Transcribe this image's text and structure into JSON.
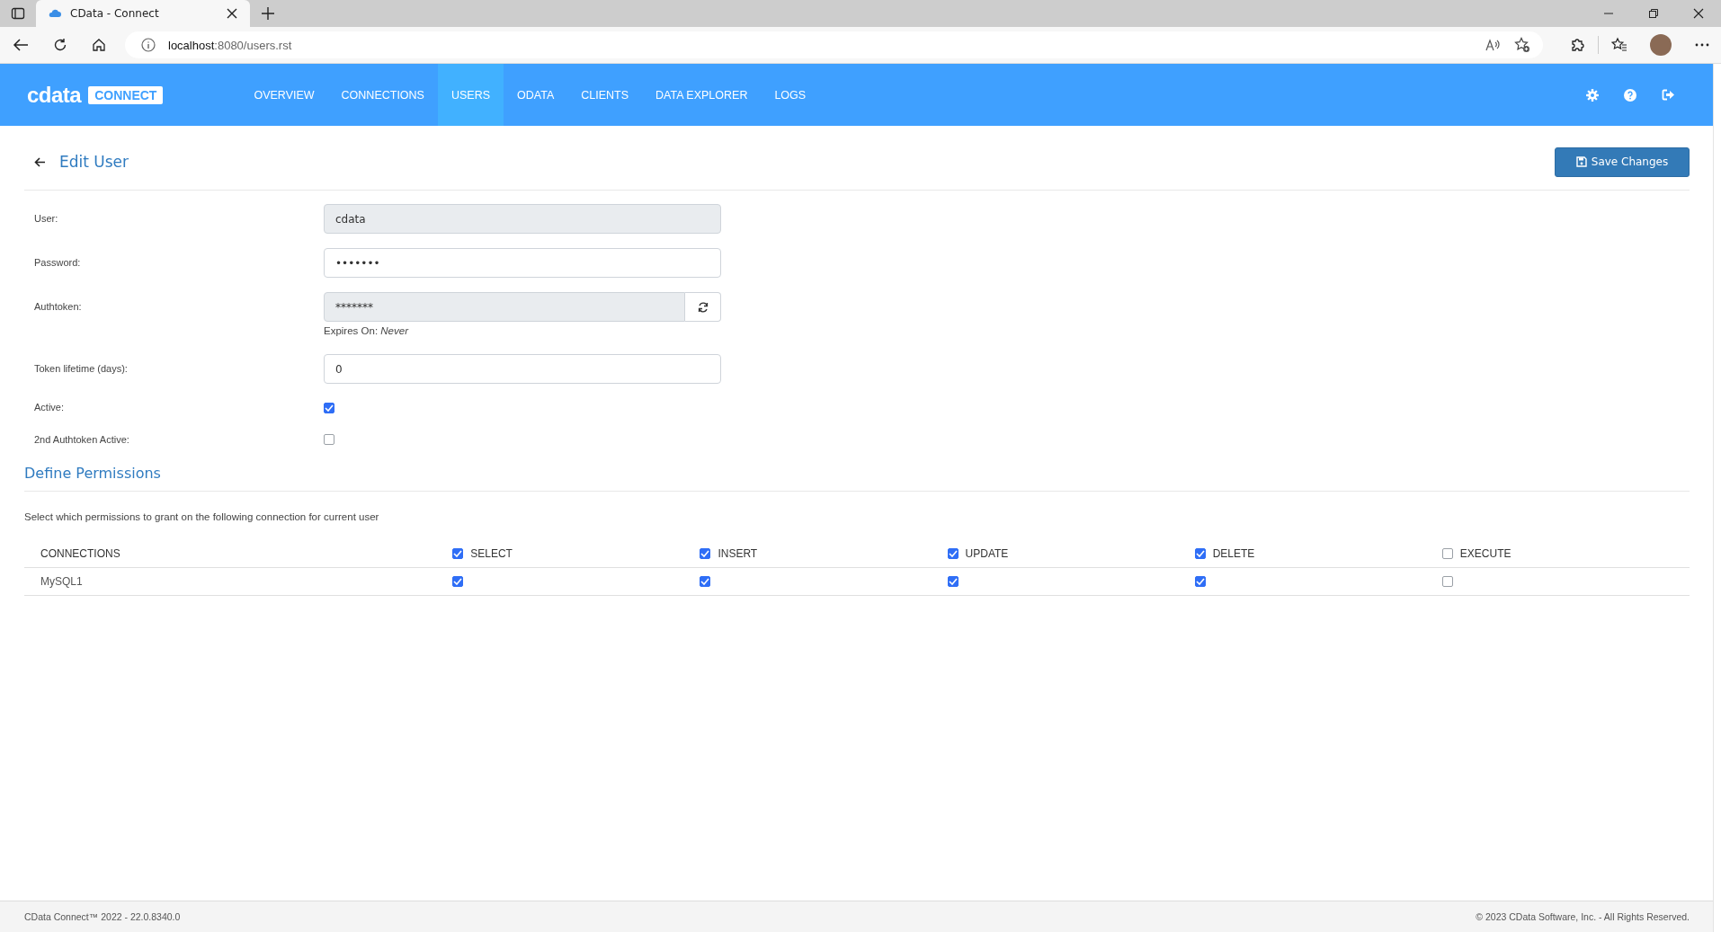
{
  "browser": {
    "tab_title": "CData - Connect",
    "url_host": "localhost",
    "url_path": ":8080/users.rst"
  },
  "header": {
    "logo_text": "cdata",
    "logo_badge": "CONNECT",
    "nav": [
      {
        "label": "OVERVIEW",
        "selected": false
      },
      {
        "label": "CONNECTIONS",
        "selected": false
      },
      {
        "label": "USERS",
        "selected": true
      },
      {
        "label": "ODATA",
        "selected": false
      },
      {
        "label": "CLIENTS",
        "selected": false
      },
      {
        "label": "DATA EXPLORER",
        "selected": false
      },
      {
        "label": "LOGS",
        "selected": false
      }
    ]
  },
  "page": {
    "title": "Edit User",
    "save_button": "Save Changes"
  },
  "form": [
    {
      "kind": "text",
      "label": "User:",
      "value": "cdata",
      "disabled": true
    },
    {
      "kind": "text",
      "label": "Password:",
      "value": "•••••••",
      "disabled": false
    },
    {
      "kind": "token",
      "label": "Authtoken:",
      "value": "*******",
      "disabled": true,
      "expires_label": "Expires On:",
      "expires_value": "Never"
    },
    {
      "kind": "text",
      "label": "Token lifetime (days):",
      "value": "0",
      "disabled": false
    },
    {
      "kind": "checkbox",
      "label": "Active:",
      "checked": true
    },
    {
      "kind": "checkbox",
      "label": "2nd Authtoken Active:",
      "checked": false
    }
  ],
  "permissions": {
    "title": "Define Permissions",
    "description": "Select which permissions to grant on the following connection for current user",
    "first_column": "CONNECTIONS",
    "columns": [
      {
        "label": "SELECT",
        "checked": true
      },
      {
        "label": "INSERT",
        "checked": true
      },
      {
        "label": "UPDATE",
        "checked": true
      },
      {
        "label": "DELETE",
        "checked": true
      },
      {
        "label": "EXECUTE",
        "checked": false
      }
    ],
    "rows": [
      {
        "name": "MySQL1",
        "cells": [
          {
            "checked": true
          },
          {
            "checked": true
          },
          {
            "checked": true
          },
          {
            "checked": true
          },
          {
            "checked": false
          }
        ]
      }
    ]
  },
  "footer": {
    "left": "CData Connect™ 2022 - 22.0.8340.0",
    "right": "© 2023 CData Software, Inc. - All Rights Reserved."
  }
}
